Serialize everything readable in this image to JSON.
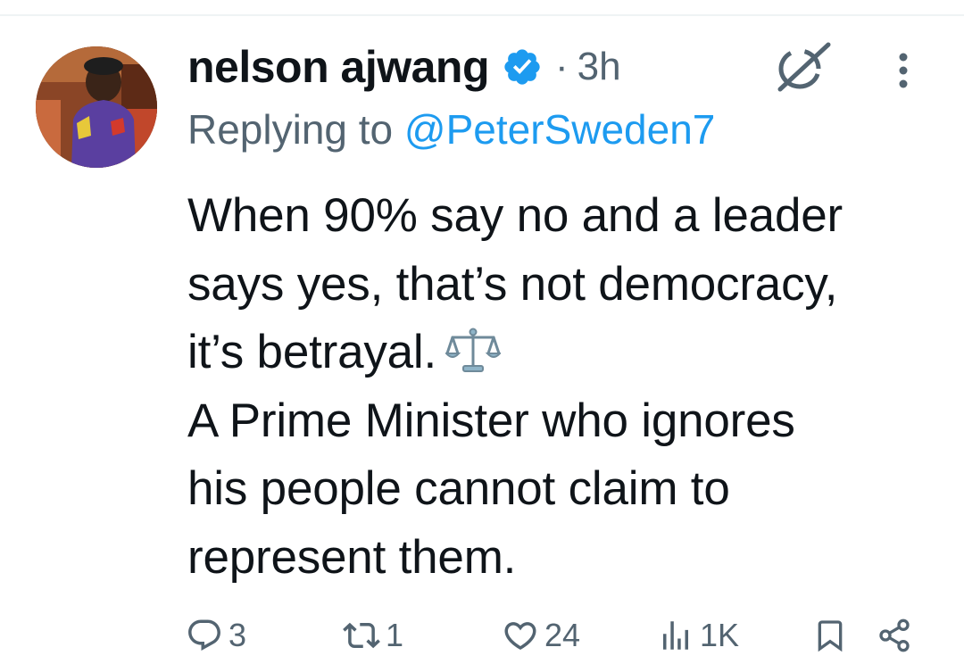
{
  "tweet": {
    "author": {
      "display_name": "nelson ajwang",
      "verified": true,
      "avatar": "user-photo"
    },
    "separator": "·",
    "time": "3h",
    "replying_to": {
      "prefix": "Replying to ",
      "handle": "@PeterSweden7"
    },
    "text_lines": [
      "When 90% say no and a leader",
      "says yes, that’s not democracy,",
      "it’s betrayal.",
      "A Prime Minister who ignores",
      "his people cannot claim to",
      "represent them."
    ],
    "emoji": "balance-scale-icon",
    "actions": {
      "replies": "3",
      "reposts": "1",
      "likes": "24",
      "views": "1K"
    }
  },
  "colors": {
    "text": "#0f1419",
    "secondary": "#536471",
    "link": "#1d9bf0",
    "verified_badge": "#1d9bf0",
    "divider": "#eff3f4"
  },
  "icons": [
    "reply-icon",
    "repost-icon",
    "like-icon",
    "views-icon",
    "bookmark-icon",
    "share-icon",
    "grok-icon",
    "more-icon",
    "verified-icon"
  ]
}
